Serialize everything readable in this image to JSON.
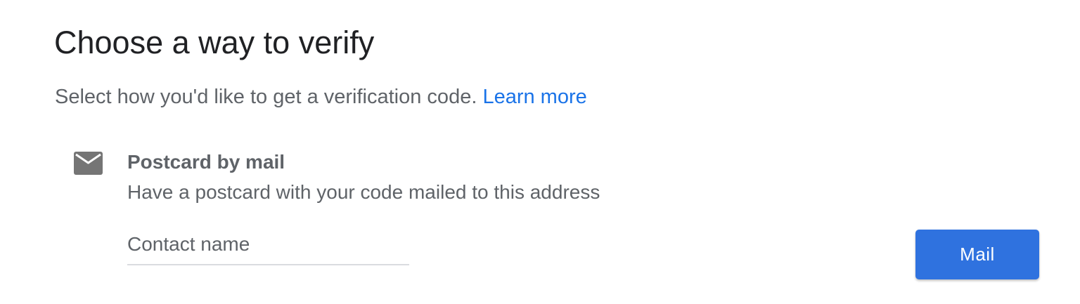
{
  "header": {
    "title": "Choose a way to verify"
  },
  "intro": {
    "text": "Select how you'd like to get a verification code.",
    "link_label": "Learn more"
  },
  "option": {
    "icon": "mail-envelope-icon",
    "title": "Postcard by mail",
    "description": "Have a postcard with your code mailed to this address"
  },
  "contact_field": {
    "placeholder": "Contact name",
    "value": ""
  },
  "actions": {
    "mail_label": "Mail"
  },
  "colors": {
    "accent": "#2f72df",
    "link": "#1a73e8",
    "secondary_text": "#5f6368",
    "icon": "#757575"
  }
}
